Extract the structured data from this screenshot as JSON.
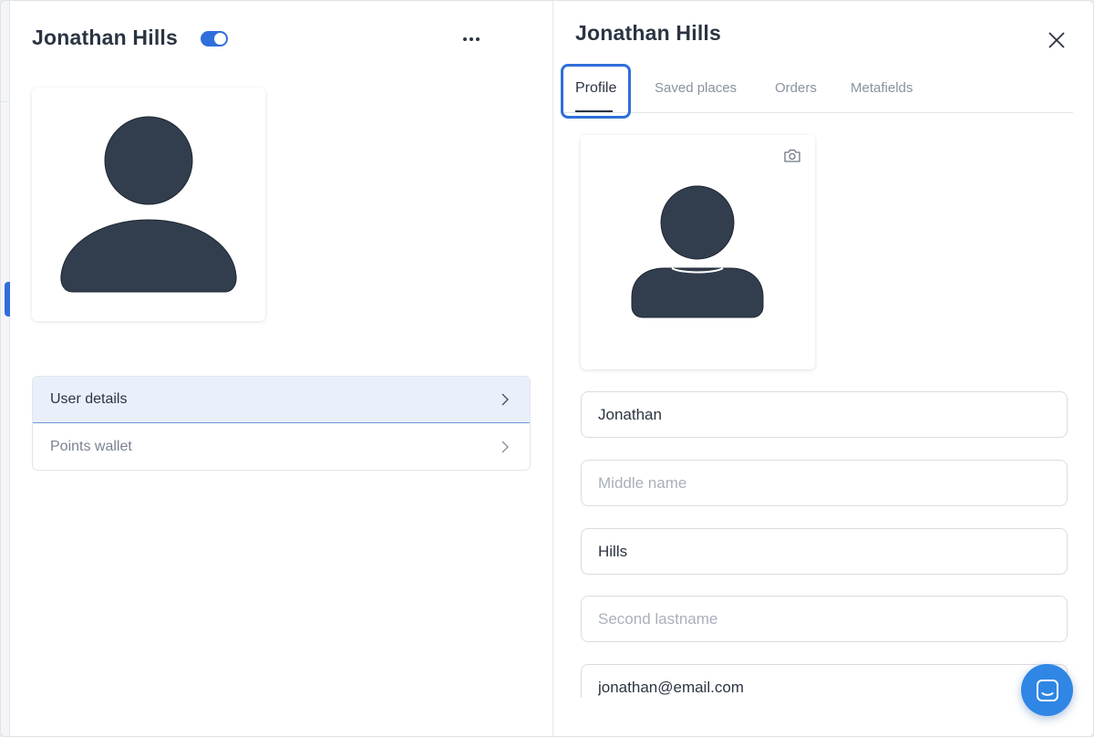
{
  "left_panel": {
    "title": "Jonathan Hills",
    "toggle_state": "on",
    "more_icon": "more-horizontal-icon",
    "detail_items": [
      {
        "label": "User details",
        "active": true
      },
      {
        "label": "Points wallet",
        "active": false
      }
    ]
  },
  "right_panel": {
    "title": "Jonathan Hills",
    "close_icon": "close-icon",
    "tabs": [
      {
        "label": "Profile",
        "active": true
      },
      {
        "label": "Saved places",
        "active": false
      },
      {
        "label": "Orders",
        "active": false
      },
      {
        "label": "Metafields",
        "active": false
      }
    ],
    "camera_icon": "camera-icon",
    "fields": {
      "first_name": {
        "value": "Jonathan",
        "placeholder": ""
      },
      "middle_name": {
        "value": "",
        "placeholder": "Middle name"
      },
      "last_name": {
        "value": "Hills",
        "placeholder": ""
      },
      "second_lastname": {
        "value": "",
        "placeholder": "Second lastname"
      },
      "email": {
        "value": "jonathan@email.com",
        "placeholder": ""
      }
    }
  },
  "chat_icon": "chat-icon",
  "colors": {
    "accent": "#2f6fdb",
    "avatar": "#323d4d",
    "active_row_bg": "#e9f0fb",
    "chat_button": "#2f86e4"
  }
}
